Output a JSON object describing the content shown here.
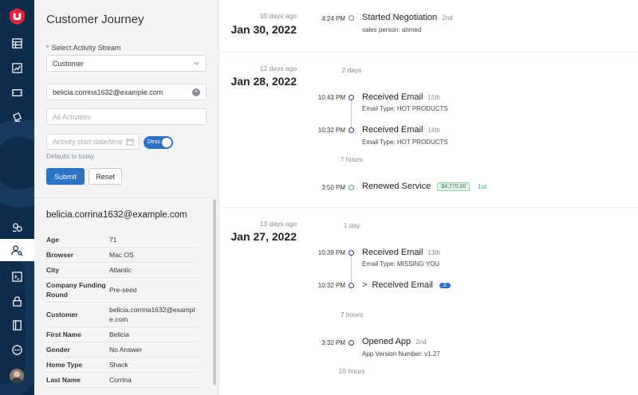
{
  "sidebar_panel": {
    "title": "Customer Journey",
    "stream_label": "Select Activity Stream",
    "stream_value": "Customer",
    "search_value": "belicia.corrina1632@example.com",
    "activities_placeholder": "All Activities",
    "date_placeholder": "Activity start date/time",
    "sort_toggle": "Desc",
    "defaults_hint": "Defaults to today",
    "submit_label": "Submit",
    "reset_label": "Reset"
  },
  "profile": {
    "email": "belicia.corrina1632@example.com",
    "rows": [
      {
        "key": "Age",
        "value": "71"
      },
      {
        "key": "Browser",
        "value": "Mac OS"
      },
      {
        "key": "City",
        "value": "Atlantic"
      },
      {
        "key": "Company Funding Round",
        "value": "Pre-seed"
      },
      {
        "key": "Customer",
        "value": "belicia.corrina1632@example.com"
      },
      {
        "key": "First Name",
        "value": "Belicia"
      },
      {
        "key": "Gender",
        "value": "No Answer"
      },
      {
        "key": "Home Type",
        "value": "Shack"
      },
      {
        "key": "Last Name",
        "value": "Corrina"
      }
    ]
  },
  "timeline": {
    "days": [
      {
        "ago": "10 days ago",
        "date": "Jan 30, 2022"
      },
      {
        "ago": "12 days ago",
        "date": "Jan 28, 2022",
        "gap": "2 days"
      },
      {
        "ago": "13 days ago",
        "date": "Jan 27, 2022",
        "gap": "1 day"
      }
    ],
    "events": [
      {
        "time": "4:24 PM",
        "title": "Started Negotiation",
        "ordinal": "2nd",
        "sub": "sales person:  ahmed"
      },
      {
        "time": "10:43 PM",
        "title": "Received Email",
        "ordinal": "15th",
        "sub": "Email Type:  HOT PRODUCTS"
      },
      {
        "time": "10:32 PM",
        "title": "Received Email",
        "ordinal": "14th",
        "sub": "Email Type:  HOT PRODUCTS"
      },
      {
        "time": "3:50 PM",
        "title": "Renewed Service",
        "amount": "$4,770.00",
        "ordinal": "1st"
      },
      {
        "time": "10:39 PM",
        "title": "Received Email",
        "ordinal": "13th",
        "sub": "Email Type:  MISSING YOU"
      },
      {
        "time": "10:32 PM",
        "title": "Received Email",
        "count": "2"
      },
      {
        "time": "3:32 PM",
        "title": "Opened App",
        "ordinal": "2nd",
        "sub": "App Version Number:  v1.27"
      }
    ],
    "gaps": [
      "7 hours",
      "7 hours",
      "10 hours"
    ]
  },
  "colors": {
    "rail": "#0f2b4b",
    "accent": "#2c72c7",
    "logo": "#d7263d"
  },
  "icons": {
    "rail": [
      "table-icon",
      "report-icon",
      "ticket-icon",
      "ticket-alt-icon",
      "segments-icon",
      "user-search-icon",
      "terminal-icon",
      "lock-icon",
      "book-icon",
      "chat-icon"
    ]
  }
}
